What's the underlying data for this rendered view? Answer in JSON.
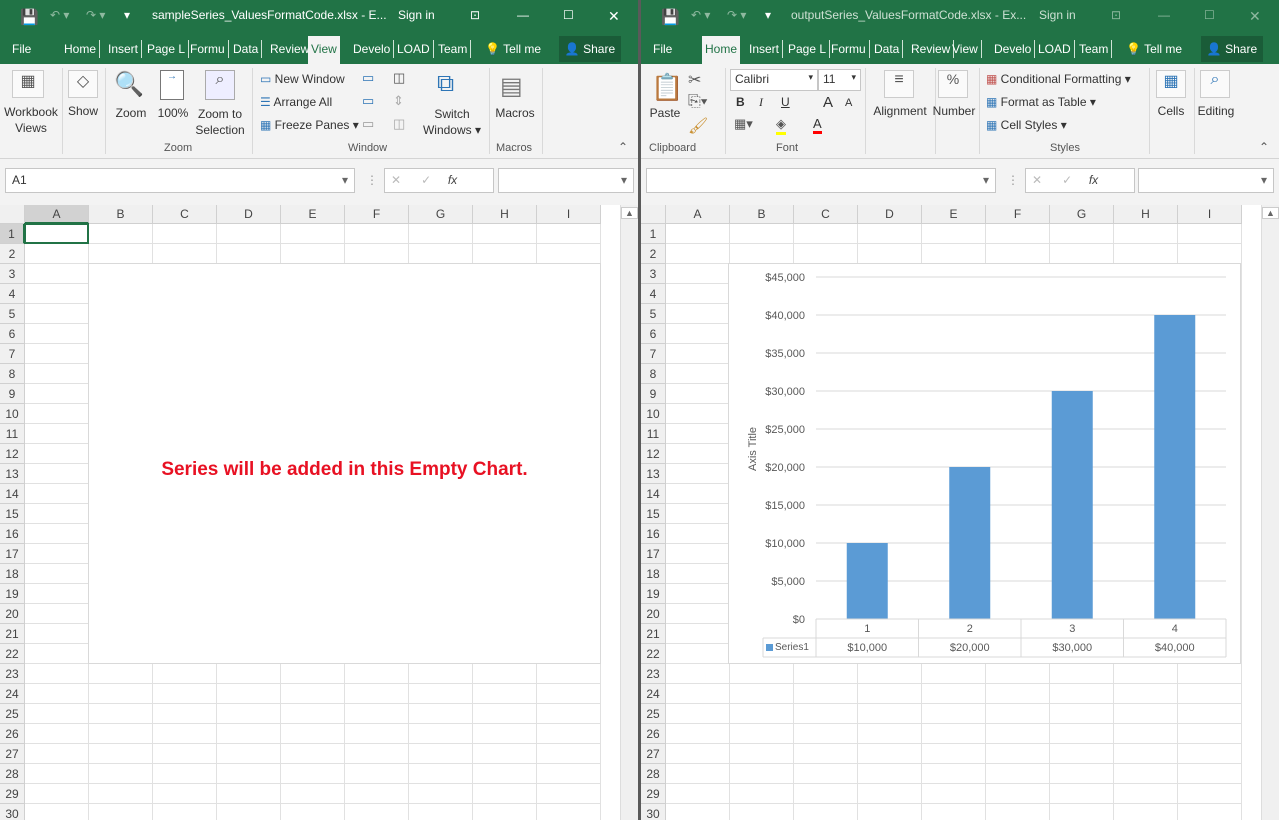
{
  "left": {
    "title": "sampleSeries_ValuesFormatCode.xlsx  -  E...",
    "sign_in": "Sign in",
    "tabs": [
      "File",
      "Home",
      "Insert",
      "Page L",
      "Formu",
      "Data",
      "Review",
      "View",
      "Develo",
      "LOAD",
      "Team"
    ],
    "active_tab": "View",
    "tell_me": "Tell me",
    "share": "Share",
    "ribbon": {
      "workbook_views": "Workbook Views",
      "show": "Show",
      "zoom": "Zoom",
      "zoom100": "100%",
      "zoom_selection": "Zoom to Selection",
      "new_window": "New Window",
      "arrange_all": "Arrange All",
      "freeze_panes": "Freeze Panes",
      "switch_windows": "Switch Windows",
      "macros": "Macros",
      "groups": {
        "zoom": "Zoom",
        "window": "Window",
        "macros": "Macros"
      }
    },
    "name_box": "A1",
    "fx": "fx",
    "selected_cell": "A1",
    "chart_message": "Series will be added in this Empty Chart."
  },
  "right": {
    "title": "outputSeries_ValuesFormatCode.xlsx  -  Ex...",
    "sign_in": "Sign in",
    "tabs": [
      "File",
      "Home",
      "Insert",
      "Page L",
      "Formu",
      "Data",
      "Review",
      "View",
      "Develo",
      "LOAD",
      "Team"
    ],
    "active_tab": "Home",
    "tell_me": "Tell me",
    "share": "Share",
    "ribbon": {
      "paste": "Paste",
      "font_name": "Calibri",
      "font_size": "11",
      "bold": "B",
      "italic": "I",
      "underline": "U",
      "alignment": "Alignment",
      "number": "Number",
      "conditional_formatting": "Conditional Formatting",
      "format_as_table": "Format as Table",
      "cell_styles": "Cell Styles",
      "cells": "Cells",
      "editing": "Editing",
      "groups": {
        "clipboard": "Clipboard",
        "font": "Font",
        "styles": "Styles"
      }
    },
    "name_box": "",
    "fx": "fx"
  },
  "columns": [
    "A",
    "B",
    "C",
    "D",
    "E",
    "F",
    "G",
    "H",
    "I"
  ],
  "rows": [
    1,
    2,
    3,
    4,
    5,
    6,
    7,
    8,
    9,
    10,
    11,
    12,
    13,
    14,
    15,
    16,
    17,
    18,
    19,
    20,
    21,
    22,
    23,
    24,
    25,
    26,
    27,
    28,
    29,
    30
  ],
  "chart_data": {
    "type": "bar",
    "categories": [
      "1",
      "2",
      "3",
      "4"
    ],
    "series": [
      {
        "name": "Series1",
        "values": [
          10000,
          20000,
          30000,
          40000
        ]
      }
    ],
    "ylabel": "Axis Title",
    "ylim": [
      0,
      45000
    ],
    "yticks": [
      "$0",
      "$5,000",
      "$10,000",
      "$15,000",
      "$20,000",
      "$25,000",
      "$30,000",
      "$35,000",
      "$40,000",
      "$45,000"
    ],
    "data_table": [
      "$10,000",
      "$20,000",
      "$30,000",
      "$40,000"
    ],
    "grid": true,
    "color": "#5b9bd5"
  }
}
